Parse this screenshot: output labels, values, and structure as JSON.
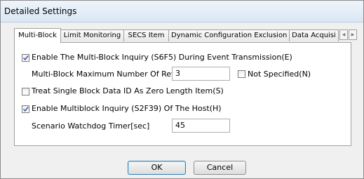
{
  "window": {
    "title": "Detailed Settings"
  },
  "tabs": [
    {
      "label": "Multi-Block",
      "active": true
    },
    {
      "label": "Limit Monitoring",
      "active": false
    },
    {
      "label": "SECS Item",
      "active": false
    },
    {
      "label": "Dynamic Configuration Exclusion",
      "active": false
    },
    {
      "label": "Data Acquisi",
      "active": false
    }
  ],
  "tab_scroll": {
    "left_icon": "arrow-left-icon",
    "right_icon": "arrow-right-icon"
  },
  "multiblock": {
    "enable_inquiry": {
      "label": "Enable The Multi-Block Inquiry (S6F5) During Event Transmission(E)",
      "checked": true
    },
    "max_retry": {
      "label": "Multi-Block Maximum Number Of Retry",
      "value": "3"
    },
    "not_specified": {
      "label": "Not Specified(N)",
      "checked": false
    },
    "treat_single_block": {
      "label": "Treat Single Block Data ID As Zero Length Item(S)",
      "checked": false
    },
    "enable_host_inquiry": {
      "label": "Enable Multiblock Inquiry (S2F39) Of The Host(H)",
      "checked": true
    },
    "watchdog": {
      "label": "Scenario Watchdog Timer[sec]",
      "value": "45"
    }
  },
  "buttons": {
    "ok": "OK",
    "cancel": "Cancel"
  }
}
